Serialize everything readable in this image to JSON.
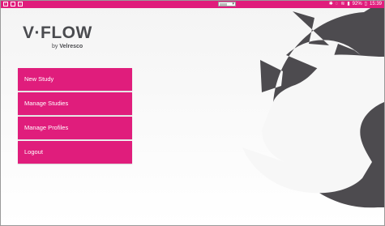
{
  "status_bar": {
    "left_icons": [
      "notification-icon",
      "image-icon",
      "download-icon"
    ],
    "battery": "92%",
    "time": "15:39"
  },
  "logo": {
    "brand": "V·FLOW",
    "by_prefix": "by",
    "by_company": "Velresco"
  },
  "menu": {
    "items": [
      {
        "label": "New Study"
      },
      {
        "label": "Manage Studies"
      },
      {
        "label": "Manage Profiles"
      },
      {
        "label": "Logout"
      }
    ]
  },
  "colors": {
    "accent": "#e01d7c",
    "emblem": "#4d4b4f"
  }
}
